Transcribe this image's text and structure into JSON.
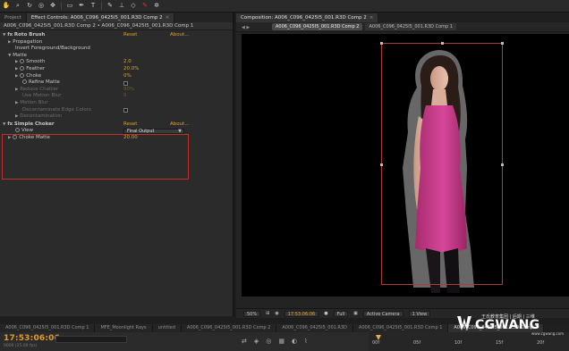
{
  "toolbar": {
    "tools": [
      "hand-icon",
      "zoom-icon",
      "rotate-icon",
      "camera-icon",
      "pan-behind-icon",
      "rectangle-icon",
      "pen-icon",
      "text-icon",
      "brush-icon",
      "clone-icon",
      "eraser-icon",
      "roto-brush-icon",
      "puppet-icon"
    ]
  },
  "effect_panel": {
    "tabs": [
      {
        "label": "Project"
      },
      {
        "label": "Effect Controls: A006_C096_0425I5_001.R3D Comp 2"
      }
    ],
    "breadcrumb": "A006_C096_0425I5_001.R3D Comp 2 • A006_C096_0425I5_001.R3D Comp 1",
    "rows": [
      {
        "indent": 0,
        "fx": true,
        "label": "Roto Brush",
        "reset": "Reset",
        "about": "About..."
      },
      {
        "indent": 1,
        "label": "Propagation"
      },
      {
        "indent": 1,
        "label": "Invert Foreground/Background"
      },
      {
        "indent": 0,
        "label": "Matte",
        "twirl": true
      },
      {
        "indent": 2,
        "label": "Smooth",
        "value": "2.0",
        "stopwatch": true
      },
      {
        "indent": 2,
        "label": "Feather",
        "value": "20.0%",
        "stopwatch": true
      },
      {
        "indent": 2,
        "label": "Choke",
        "value": "0%",
        "stopwatch": true
      },
      {
        "indent": 2,
        "label": "Refine Matte",
        "checkbox": true,
        "stopwatch": true
      },
      {
        "indent": 2,
        "label": "Reduce Chatter",
        "value": "90%",
        "dim": true
      },
      {
        "indent": 2,
        "label": "Use Motion Blur",
        "value": "0",
        "dim": true
      },
      {
        "indent": 2,
        "label": "Motion Blur"
      },
      {
        "indent": 3,
        "label": "Decontaminate Edge Colors",
        "dim": true,
        "checkbox": true
      },
      {
        "indent": 3,
        "label": "Decontamination",
        "dim": true
      }
    ],
    "simple_choker": {
      "name": "Simple Choker",
      "reset": "Reset",
      "about": "About...",
      "view_label": "View",
      "view_value": "Final Output",
      "choke_label": "Choke Matte",
      "choke_value": "20.00"
    }
  },
  "comp_panel": {
    "tab": "Composition: A006_C096_0425I5_001.R3D Comp 2",
    "subtabs": [
      "A006_C096_0425I5_001.R3D Comp 2",
      "A006_C096_0425I5_001.R3D Comp 1"
    ],
    "viewer_bar": {
      "zoom": "50%",
      "timecode": "17:53:06:06",
      "resolution": "Full",
      "camera": "Active Camera",
      "views": "1 View"
    }
  },
  "timeline": {
    "tabs": [
      "A006_C096_0425I5_001.R3D Comp 1",
      "MFE_Moonlight Rays",
      "untitled",
      "A006_C096_0425I5_001.R3D Comp 2",
      "A006_C096_0425I5_001.R3D",
      "A006_C096_0425I5_001.R3D Comp 1",
      "A006_C096_0425I5_001.R3D Comp 2"
    ],
    "current_time": "17:53:06:06",
    "frame_count": "0000 (25.00 fps)",
    "ticks": [
      "00f",
      "05f",
      "10f",
      "15f",
      "20f"
    ]
  },
  "watermark": {
    "text": "CGWANG",
    "subtitle": "王氏教育集团 | 后期 | 三维",
    "url": "www.cgwang.com"
  }
}
